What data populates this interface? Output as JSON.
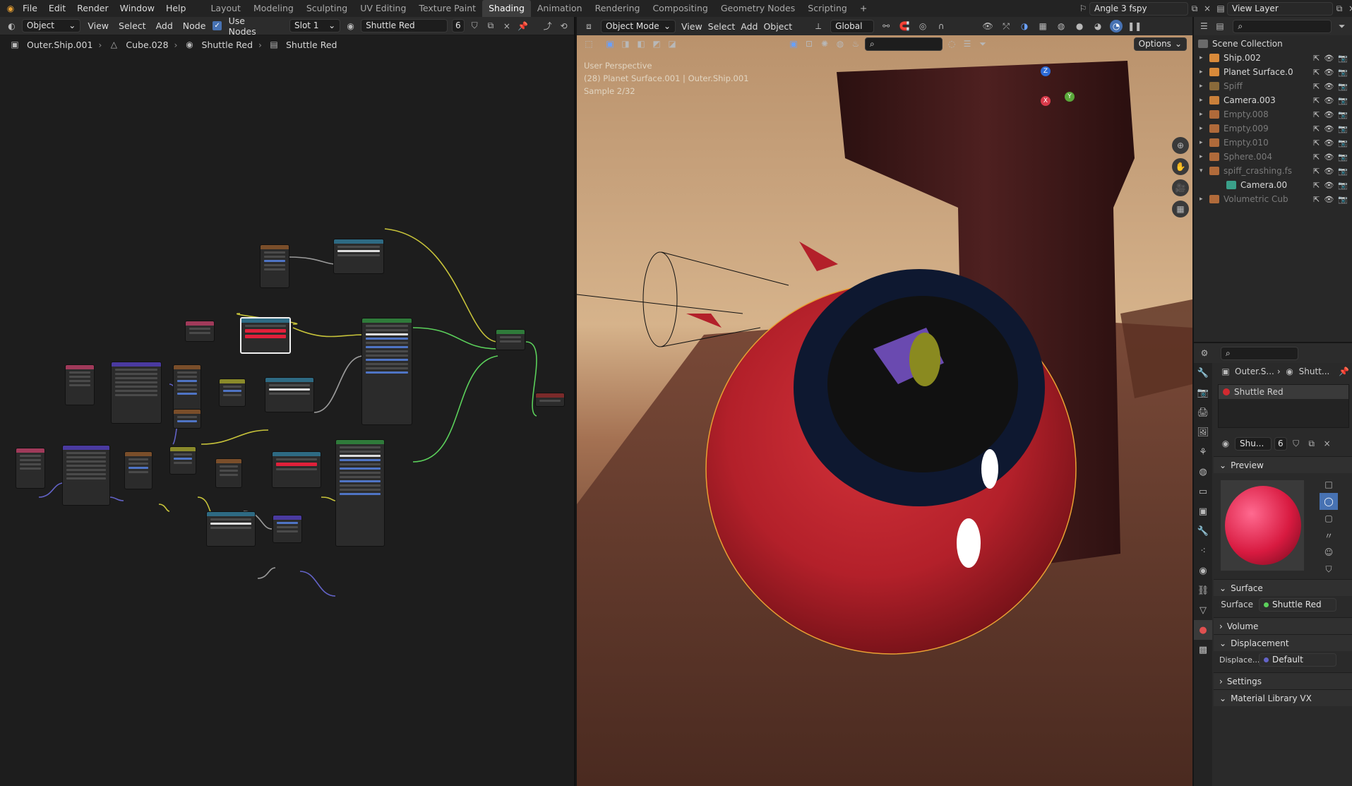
{
  "menu": [
    "File",
    "Edit",
    "Render",
    "Window",
    "Help"
  ],
  "workspaces": [
    "Layout",
    "Modeling",
    "Sculpting",
    "UV Editing",
    "Texture Paint",
    "Shading",
    "Animation",
    "Rendering",
    "Compositing",
    "Geometry Nodes",
    "Scripting"
  ],
  "active_workspace": "Shading",
  "scene_name": "Angle 3 fspy",
  "view_layer": "View Layer",
  "node_editor": {
    "mode": "Object",
    "menu": [
      "View",
      "Select",
      "Add",
      "Node"
    ],
    "use_nodes_label": "Use Nodes",
    "slot": "Slot 1",
    "material": "Shuttle Red",
    "users": "6",
    "breadcrumb": [
      "Outer.Ship.001",
      "Cube.028",
      "Shuttle Red",
      "Shuttle Red"
    ]
  },
  "viewport": {
    "mode": "Object Mode",
    "menu": [
      "View",
      "Select",
      "Add",
      "Object"
    ],
    "orientation": "Global",
    "options_label": "Options",
    "info_lines": [
      "User Perspective",
      "(28) Planet Surface.001 | Outer.Ship.001",
      "Sample 2/32"
    ]
  },
  "outliner": {
    "root": "Scene Collection",
    "items": [
      {
        "name": "Ship.002",
        "dim": false
      },
      {
        "name": "Planet Surface.0",
        "dim": false
      },
      {
        "name": "Spiff",
        "dim": true
      },
      {
        "name": "Camera.003",
        "dim": false
      },
      {
        "name": "Empty.008",
        "dim": true
      },
      {
        "name": "Empty.009",
        "dim": true
      },
      {
        "name": "Empty.010",
        "dim": true
      },
      {
        "name": "Sphere.004",
        "dim": true
      },
      {
        "name": "spiff_crashing.fs",
        "dim": true
      },
      {
        "name": "Camera.00",
        "dim": false
      },
      {
        "name": "Volumetric Cub",
        "dim": true
      }
    ]
  },
  "properties": {
    "breadcrumb_obj": "Outer.S...",
    "breadcrumb_mat": "Shutt...",
    "slot_name": "Shuttle Red",
    "material_short": "Shu...",
    "users": "6",
    "panels": {
      "preview": "Preview",
      "surface": "Surface",
      "surface_label": "Surface",
      "surface_value": "Shuttle Red",
      "volume": "Volume",
      "displacement": "Displacement",
      "displace_label": "Displace...",
      "displace_value": "Default",
      "settings": "Settings",
      "matlib": "Material Library VX"
    }
  },
  "colors": {
    "accent": "#4772b3",
    "header_bg": "#232323",
    "ship_red": "#b51f25"
  }
}
